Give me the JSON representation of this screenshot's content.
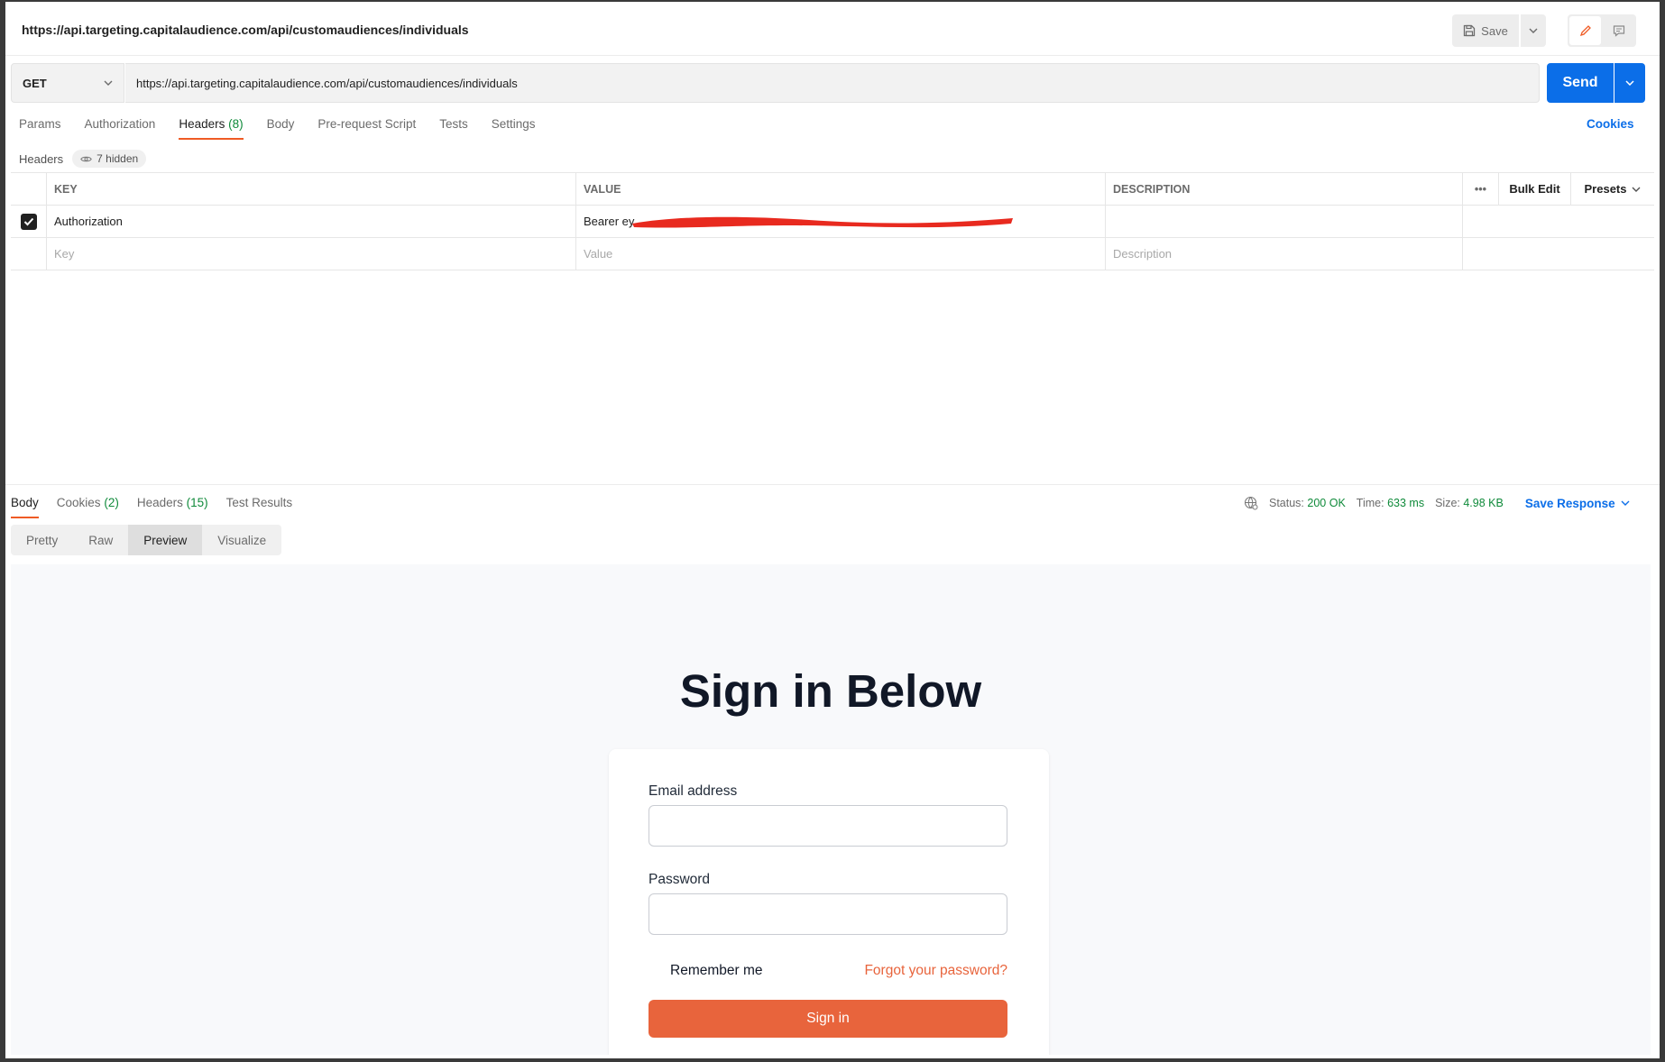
{
  "titlebar": {
    "title": "https://api.targeting.capitalaudience.com/api/customaudiences/individuals",
    "save_label": "Save"
  },
  "request": {
    "method": "GET",
    "url": "https://api.targeting.capitalaudience.com/api/customaudiences/individuals",
    "send_label": "Send"
  },
  "req_tabs": [
    {
      "label": "Params"
    },
    {
      "label": "Authorization"
    },
    {
      "label": "Headers",
      "count": "(8)"
    },
    {
      "label": "Body"
    },
    {
      "label": "Pre-request Script"
    },
    {
      "label": "Tests"
    },
    {
      "label": "Settings"
    }
  ],
  "cookies_label": "Cookies",
  "headers_sub": {
    "label": "Headers",
    "hidden": "7 hidden"
  },
  "table": {
    "col_key": "KEY",
    "col_value": "VALUE",
    "col_desc": "DESCRIPTION",
    "more": "•••",
    "bulk_edit": "Bulk Edit",
    "presets": "Presets",
    "row": {
      "key": "Authorization",
      "value": "Bearer ey"
    },
    "placeholder_key": "Key",
    "placeholder_value": "Value",
    "placeholder_desc": "Description"
  },
  "response": {
    "tabs": [
      {
        "label": "Body"
      },
      {
        "label": "Cookies",
        "count": "(2)"
      },
      {
        "label": "Headers",
        "count": "(15)"
      },
      {
        "label": "Test Results"
      }
    ],
    "status_label": "Status:",
    "status_value": "200 OK",
    "time_label": "Time:",
    "time_value": "633 ms",
    "size_label": "Size:",
    "size_value": "4.98 KB",
    "save_response": "Save Response",
    "views": [
      "Pretty",
      "Raw",
      "Preview",
      "Visualize"
    ]
  },
  "preview": {
    "title": "Sign in Below",
    "email_label": "Email address",
    "password_label": "Password",
    "remember": "Remember me",
    "forgot": "Forgot your password?",
    "signin": "Sign in"
  },
  "colors": {
    "accent": "#ef5b25",
    "primary": "#0b6ee8",
    "success": "#0f8a3a",
    "signin": "#e8643c"
  },
  "icons": [
    "save-icon",
    "chevron-down-icon",
    "pencil-icon",
    "comment-icon",
    "eye-icon",
    "check-icon",
    "globe-icon"
  ]
}
